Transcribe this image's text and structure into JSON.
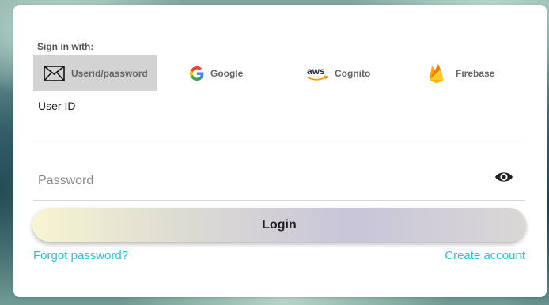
{
  "signin": {
    "label": "Sign in with:",
    "providers": [
      {
        "label": "Userid/password",
        "icon": "mail-icon",
        "active": true
      },
      {
        "label": "Google",
        "icon": "google-icon",
        "active": false
      },
      {
        "label": "Cognito",
        "icon": "aws-icon",
        "active": false
      },
      {
        "label": "Firebase",
        "icon": "firebase-icon",
        "active": false
      }
    ]
  },
  "aws_logo_text": "aws",
  "userid": {
    "label": "User ID",
    "value": ""
  },
  "password": {
    "placeholder": "Password",
    "value": "",
    "toggle_icon": "eye-icon"
  },
  "actions": {
    "login_label": "Login",
    "forgot_label": "Forgot password?",
    "create_label": "Create account"
  },
  "colors": {
    "link": "#1ec8dc",
    "active_provider_bg": "#d3d3d3"
  }
}
